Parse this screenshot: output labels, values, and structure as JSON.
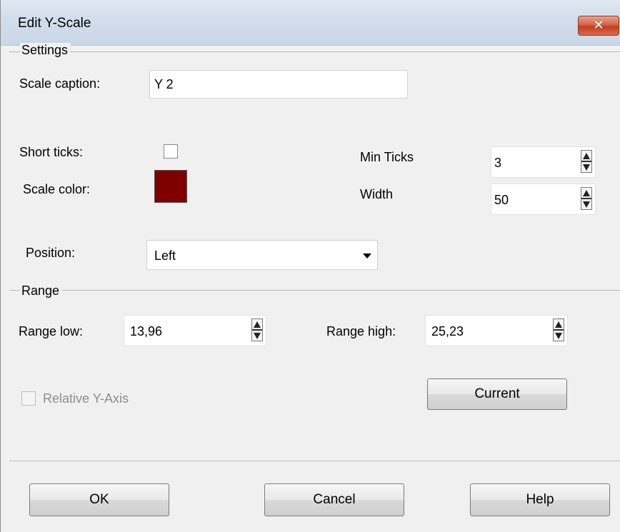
{
  "window": {
    "title": "Edit Y-Scale",
    "close_glyph": "✕",
    "close_color": "#c7462a"
  },
  "settings": {
    "group_label": "Settings",
    "scale_caption_label": "Scale caption:",
    "scale_caption_value": "Y 2",
    "short_ticks_label": "Short ticks:",
    "short_ticks_checked": false,
    "scale_color_label": "Scale color:",
    "scale_color_value": "#800000",
    "min_ticks_label": "Min Ticks",
    "min_ticks_value": "3",
    "width_label": "Width",
    "width_value": "50",
    "position_label": "Position:",
    "position_value": "Left"
  },
  "range": {
    "group_label": "Range",
    "range_low_label": "Range low:",
    "range_low_value": "13,96",
    "range_high_label": "Range high:",
    "range_high_value": "25,23",
    "relative_y_axis_label": "Relative Y-Axis",
    "relative_y_axis_checked": false,
    "current_button": "Current"
  },
  "buttons": {
    "ok": "OK",
    "cancel": "Cancel",
    "help": "Help"
  },
  "icons": {
    "close": "close-icon",
    "spin": "spin-arrows-icon",
    "dropdown": "chevron-down-icon"
  }
}
